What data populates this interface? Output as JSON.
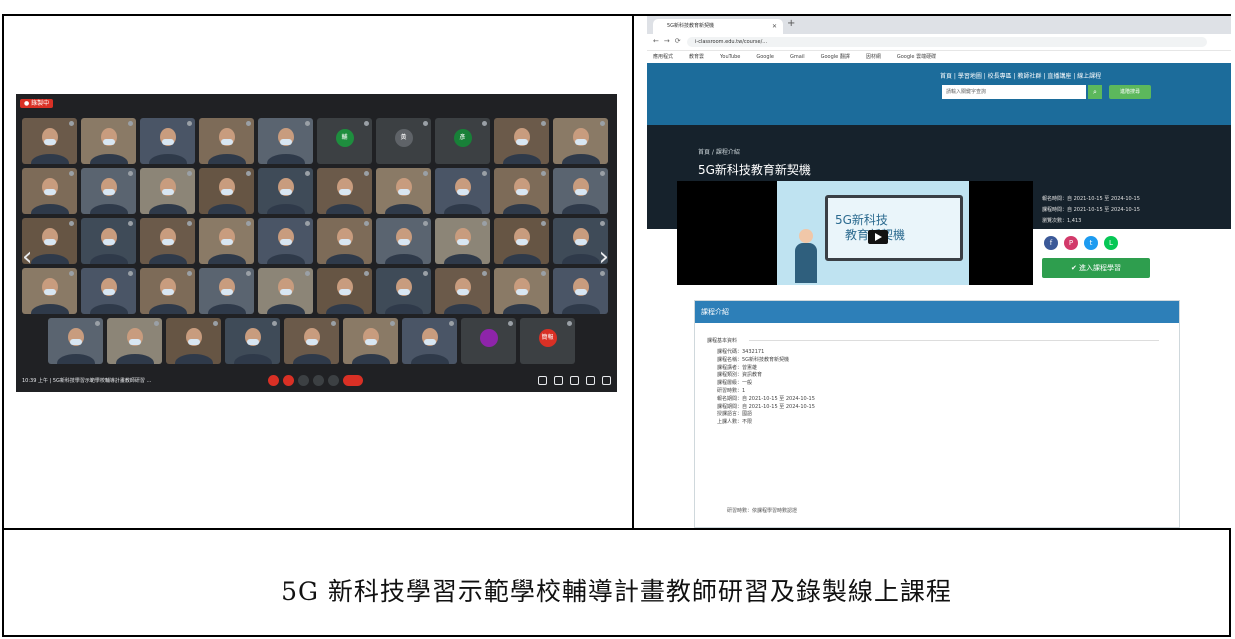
{
  "caption": "5G 新科技學習示範學校輔導計畫教師研習及錄製線上課程",
  "meet": {
    "rec_label": "● 錄製中",
    "info": "10:39 上午 | 5G新科技學習示範學校輔導計畫教師研習 ...",
    "tiles": [
      [
        {
          "kind": "video",
          "name": ""
        },
        {
          "kind": "video",
          "name": ""
        },
        {
          "kind": "video",
          "name": ""
        },
        {
          "kind": "video",
          "name": ""
        },
        {
          "kind": "video",
          "name": ""
        },
        {
          "kind": "avatar",
          "initial": "輔",
          "color": "#1e8e3e",
          "name": ""
        },
        {
          "kind": "avatar",
          "initial": "黃",
          "color": "#5f6368",
          "name": ""
        },
        {
          "kind": "avatar",
          "initial": "彥",
          "color": "#188038",
          "name": ""
        },
        {
          "kind": "video",
          "name": ""
        },
        {
          "kind": "video",
          "name": ""
        }
      ],
      [
        {
          "kind": "video",
          "name": ""
        },
        {
          "kind": "video",
          "name": ""
        },
        {
          "kind": "video",
          "name": ""
        },
        {
          "kind": "video",
          "name": ""
        },
        {
          "kind": "video",
          "name": ""
        },
        {
          "kind": "video",
          "name": ""
        },
        {
          "kind": "video",
          "name": ""
        },
        {
          "kind": "video",
          "name": ""
        },
        {
          "kind": "video",
          "name": ""
        },
        {
          "kind": "video",
          "name": ""
        }
      ],
      [
        {
          "kind": "video",
          "name": ""
        },
        {
          "kind": "video",
          "name": ""
        },
        {
          "kind": "video",
          "name": ""
        },
        {
          "kind": "video",
          "name": ""
        },
        {
          "kind": "video",
          "name": ""
        },
        {
          "kind": "video",
          "name": ""
        },
        {
          "kind": "video",
          "name": ""
        },
        {
          "kind": "video",
          "name": ""
        },
        {
          "kind": "video",
          "name": ""
        },
        {
          "kind": "video",
          "name": ""
        }
      ],
      [
        {
          "kind": "video",
          "name": ""
        },
        {
          "kind": "video",
          "name": ""
        },
        {
          "kind": "video",
          "name": ""
        },
        {
          "kind": "video",
          "name": ""
        },
        {
          "kind": "video",
          "name": ""
        },
        {
          "kind": "video",
          "name": ""
        },
        {
          "kind": "video",
          "name": ""
        },
        {
          "kind": "video",
          "name": ""
        },
        {
          "kind": "video",
          "name": ""
        },
        {
          "kind": "video",
          "name": ""
        }
      ],
      [
        {
          "kind": "video",
          "name": ""
        },
        {
          "kind": "video",
          "name": ""
        },
        {
          "kind": "video",
          "name": ""
        },
        {
          "kind": "video",
          "name": ""
        },
        {
          "kind": "video",
          "name": ""
        },
        {
          "kind": "video",
          "name": ""
        },
        {
          "kind": "video",
          "name": ""
        },
        {
          "kind": "avatar",
          "initial": "",
          "color": "#8e24aa",
          "name": ""
        },
        {
          "kind": "avatar",
          "initial": "簡報",
          "color": "#d93025",
          "name": ""
        }
      ]
    ]
  },
  "browser": {
    "tab_title": "5G新科技教育新契機",
    "url": "i-classroom.edu.tw/course/...",
    "bookmarks": [
      "應用程式",
      "教育雲",
      "YouTube",
      "Google",
      "Gmail",
      "Google 翻譯",
      "因材網",
      "Google 雲端硬碟"
    ],
    "site_nav": "首頁 | 學習地圖 | 校長專區 | 教師社群 | 直播講座 | 線上課程",
    "search_placeholder": "請輸入關鍵字查詢",
    "advanced_search": "進階搜尋",
    "breadcrumb": "首頁  /  課程介紹",
    "course_title": "5G新科技教育新契機",
    "slide_text": [
      "5G新科技",
      "教育新契機"
    ],
    "meta": [
      "報名時間：自 2021-10-15 至 2024-10-15",
      "課程時間：自 2021-10-15 至 2024-10-15",
      "瀏覽次數：1,413"
    ],
    "enroll_label": "✔ 進入課程學習",
    "intro_heading": "課程介紹",
    "info_legend": "課程基本資料",
    "info_rows": [
      "課程代碼：3432171",
      "課程名稱：5G新科技教育新契機",
      "課程講者：曾憲雄",
      "課程類別：資訊教育",
      "課程層級：一般",
      "研習時數：1",
      "報名期間：自 2021-10-15 至 2024-10-15",
      "課程期間：自 2021-10-15 至 2024-10-15",
      "授課語言：國語",
      "上課人數：不限"
    ],
    "footnote": "研習時數：依課程學習時數認證"
  },
  "colors": {
    "meet_bg": "#202124",
    "site_header": "#1c6c9b",
    "dark_band": "#16222c",
    "accent_green": "#2e9e4e",
    "panel_head": "#2d7fb8"
  }
}
